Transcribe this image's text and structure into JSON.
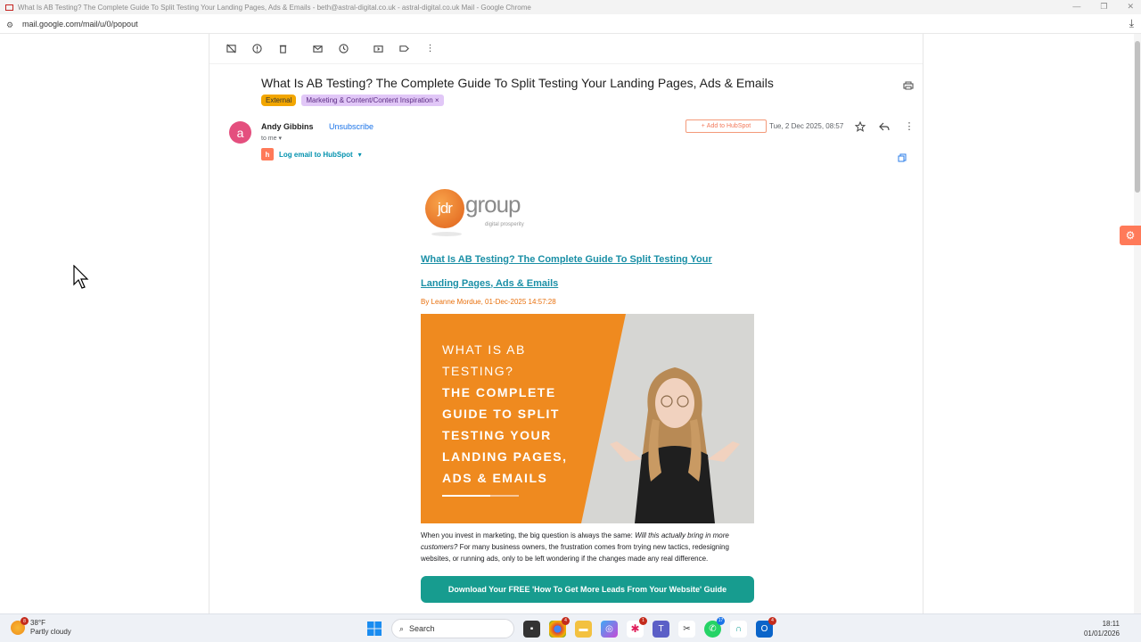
{
  "window": {
    "title": "What Is AB Testing? The Complete Guide To Split Testing Your Landing Pages, Ads & Emails - beth@astral-digital.co.uk - astral-digital.co.uk Mail - Google Chrome"
  },
  "address_bar": {
    "url": "mail.google.com/mail/u/0/popout"
  },
  "email": {
    "subject": "What Is AB Testing? The Complete Guide To Split Testing Your Landing Pages, Ads & Emails",
    "labels": {
      "external": "External",
      "category": "Marketing & Content/Content Inspiration",
      "remove": "×"
    },
    "avatar_letter": "a",
    "sender": "Andy Gibbins",
    "unsubscribe": "Unsubscribe",
    "to": "to me",
    "add_to_hubspot": "Add to HubSpot",
    "date": "Tue, 2 Dec 2025, 08:57",
    "log_email": "Log email to HubSpot"
  },
  "content": {
    "logo_main": "jdr",
    "logo_group": "group",
    "logo_tagline": "digital prosperity",
    "article_title": "What Is AB Testing? The Complete Guide To Split Testing Your Landing Pages, Ads & Emails",
    "byline": "By Leanne Mordue, 01-Dec-2025 14:57:28",
    "hero_line1": "WHAT IS AB",
    "hero_line2": "TESTING?",
    "hero_line3": "THE COMPLETE",
    "hero_line4": "GUIDE TO SPLIT",
    "hero_line5": "TESTING YOUR",
    "hero_line6": "LANDING PAGES,",
    "hero_line7": "ADS & EMAILS",
    "intro_a": "When you invest in marketing, the big question is always the same: ",
    "intro_italic": "Will this actually bring in more customers?",
    "intro_b": " For many business owners, the frustration comes from trying new tactics, redesigning websites, or running ads, only to be left wondering if the changes made any real difference.",
    "cta": "Download Your FREE 'How To Get More Leads From Your Website' Guide"
  },
  "taskbar": {
    "temperature": "38°F",
    "condition": "Partly cloudy",
    "weather_badge": "8",
    "search": "Search",
    "time": "18:11",
    "date": "01/01/2026",
    "badges": {
      "chrome": "4",
      "slack": "1",
      "whatsapp": "17",
      "outlook": "4"
    }
  },
  "colors": {
    "accent_teal": "#1a8fa6",
    "hubspot_orange": "#ff7a59",
    "cta_green": "#179c8f",
    "hero_orange": "#ef8a1f",
    "label_external": "#f2a600",
    "label_category": "#e1c7f7"
  }
}
